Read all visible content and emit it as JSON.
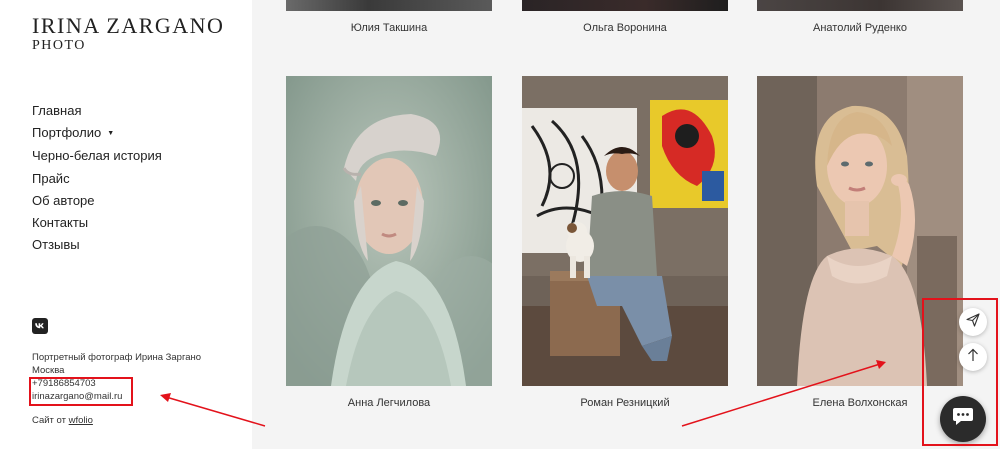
{
  "brand": {
    "line1": "IRINA ZARGANO",
    "line2": "PHOTO"
  },
  "nav": {
    "items": [
      {
        "label": "Главная"
      },
      {
        "label": "Портфолио",
        "caret": "▼"
      },
      {
        "label": "Черно-белая история"
      },
      {
        "label": "Прайс"
      },
      {
        "label": "Об авторе"
      },
      {
        "label": "Контакты"
      },
      {
        "label": "Отзывы"
      }
    ]
  },
  "social": {
    "icon": "vk-icon"
  },
  "info": {
    "description": "Портретный фотограф Ирина Заргано",
    "city": "Москва",
    "phone": "+79186854703",
    "email": "irinazargano@mail.ru"
  },
  "credit": {
    "prefix": "Сайт от",
    "link": "wfolio"
  },
  "gallery": {
    "top_row": [
      {
        "name": "Юлия Такшина"
      },
      {
        "name": "Ольга Воронина"
      },
      {
        "name": "Анатолий Руденко"
      }
    ],
    "main_row": [
      {
        "name": "Анна Легчилова"
      },
      {
        "name": "Роман Резницкий"
      },
      {
        "name": "Елена Волхонская"
      }
    ]
  },
  "floating": {
    "send_icon": "paper-plane-icon",
    "up_icon": "arrow-up-icon",
    "chat_icon": "chat-bubble-icon"
  },
  "colors": {
    "annotation_red": "#e3121b",
    "chat_button": "#2b2b2b",
    "gallery_bg": "#f4f4f4"
  }
}
